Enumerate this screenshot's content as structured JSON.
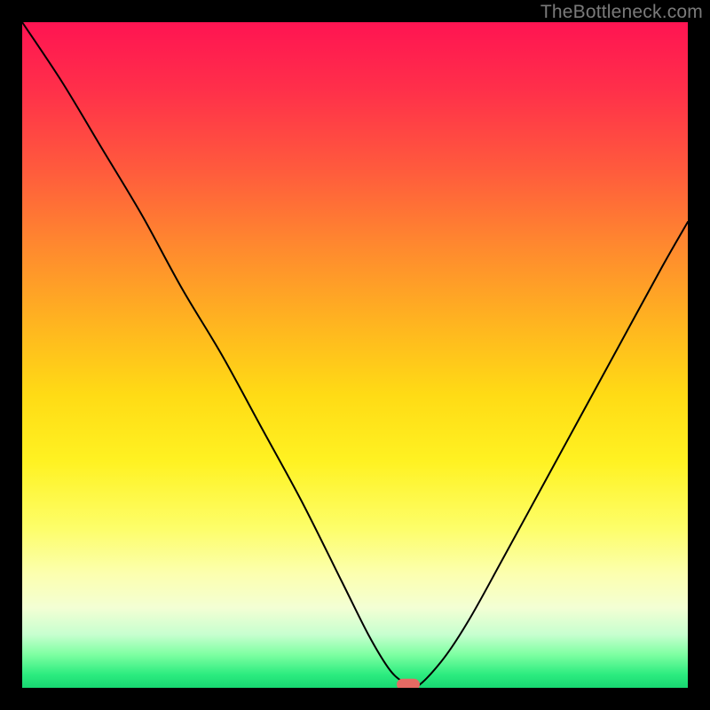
{
  "watermark": "TheBottleneck.com",
  "colors": {
    "frame": "#000000",
    "curve": "#000000",
    "marker": "#e56a63",
    "gradient_top": "#ff1452",
    "gradient_bottom": "#18d872"
  },
  "chart_data": {
    "type": "line",
    "title": "",
    "xlabel": "",
    "ylabel": "",
    "xlim": [
      0,
      100
    ],
    "ylim": [
      0,
      100
    ],
    "series": [
      {
        "name": "bottleneck-curve",
        "x": [
          0,
          6,
          12,
          18,
          24,
          30,
          36,
          42,
          48,
          52,
          55,
          57,
          59,
          63,
          67,
          72,
          78,
          84,
          90,
          96,
          100
        ],
        "values": [
          100,
          91,
          81,
          71,
          60,
          50,
          39,
          28,
          16,
          8,
          3,
          1,
          0,
          4,
          10,
          19,
          30,
          41,
          52,
          63,
          70
        ]
      }
    ],
    "annotations": [
      {
        "name": "optimal-marker",
        "x": 58,
        "y": 0.5,
        "shape": "pill"
      }
    ]
  }
}
